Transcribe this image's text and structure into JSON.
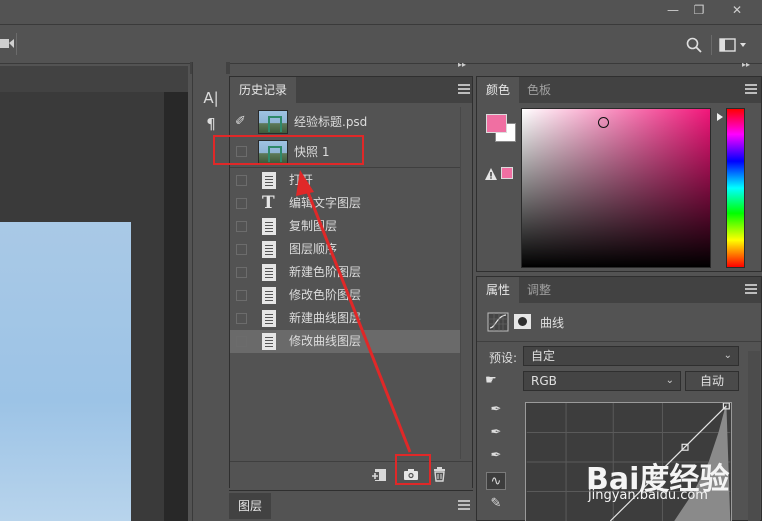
{
  "titlebar": {
    "minimize_glyph": "—",
    "restore_glyph": "❐",
    "close_glyph": "✕"
  },
  "collapsed_column": {
    "character_glyph": "A|",
    "paragraph_glyph": "¶",
    "expand_glyph": "◂◂",
    "collapse_glyph": "▸▸"
  },
  "history": {
    "tab_label": "历史记录",
    "snapshot_source": "经验标题.psd",
    "snapshot": "快照 1",
    "steps": [
      {
        "icon": "document-icon",
        "label": "打开"
      },
      {
        "icon": "text-icon",
        "label": "编辑文字图层"
      },
      {
        "icon": "document-icon",
        "label": "复制图层"
      },
      {
        "icon": "document-icon",
        "label": "图层顺序"
      },
      {
        "icon": "document-icon",
        "label": "新建色阶图层"
      },
      {
        "icon": "document-icon",
        "label": "修改色阶图层"
      },
      {
        "icon": "document-icon",
        "label": "新建曲线图层"
      },
      {
        "icon": "document-icon",
        "label": "修改曲线图层"
      }
    ],
    "selected_step": 7
  },
  "layers": {
    "tab_label": "图层"
  },
  "color": {
    "tabs": [
      "颜色",
      "色板"
    ],
    "foreground": "#f06fa2",
    "background": "#ffffff",
    "warning_swatch": "#f06fa2"
  },
  "properties": {
    "tabs": [
      "属性",
      "调整"
    ],
    "adjustment_name": "曲线",
    "preset_label": "预设:",
    "preset_value": "自定",
    "channel_value": "RGB",
    "auto_button": "自动"
  },
  "watermark": {
    "logo_text": "Bai度经验",
    "url": "jingyan.baidu.com"
  },
  "annotation_color": "#e02828"
}
